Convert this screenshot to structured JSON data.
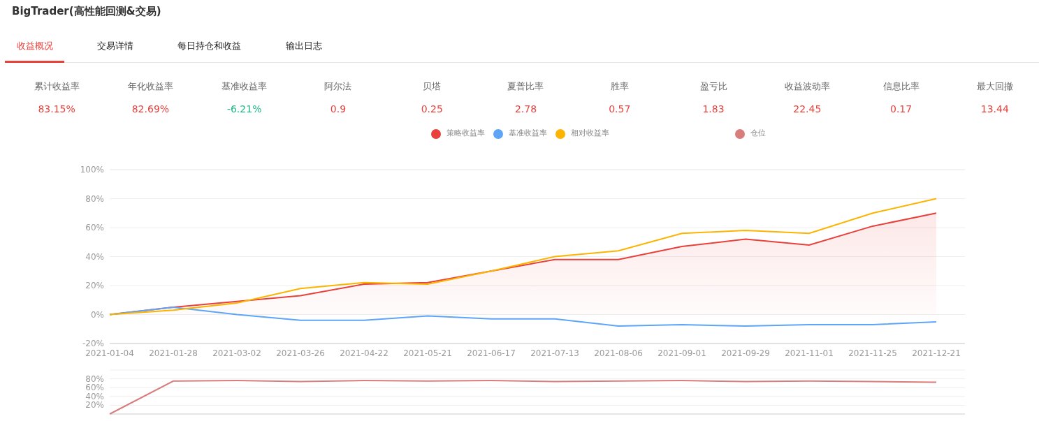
{
  "title": "BigTrader(高性能回测&交易)",
  "tabs": [
    {
      "label": "收益概况",
      "selected": true
    },
    {
      "label": "交易详情",
      "selected": false
    },
    {
      "label": "每日持仓和收益",
      "selected": false
    },
    {
      "label": "输出日志",
      "selected": false
    }
  ],
  "metrics": [
    {
      "label": "累计收益率",
      "value": "83.15%",
      "color": "#e8413c"
    },
    {
      "label": "年化收益率",
      "value": "82.69%",
      "color": "#e8413c"
    },
    {
      "label": "基准收益率",
      "value": "-6.21%",
      "color": "#1dbb86"
    },
    {
      "label": "阿尔法",
      "value": "0.9",
      "color": "#e8413c"
    },
    {
      "label": "贝塔",
      "value": "0.25",
      "color": "#e8413c"
    },
    {
      "label": "夏普比率",
      "value": "2.78",
      "color": "#e8413c"
    },
    {
      "label": "胜率",
      "value": "0.57",
      "color": "#e8413c"
    },
    {
      "label": "盈亏比",
      "value": "1.83",
      "color": "#e8413c"
    },
    {
      "label": "收益波动率",
      "value": "22.45",
      "color": "#e8413c"
    },
    {
      "label": "信息比率",
      "value": "0.17",
      "color": "#e8413c"
    },
    {
      "label": "最大回撤",
      "value": "13.44",
      "color": "#e8413c"
    }
  ],
  "returns_chart": {
    "chart_data": {
      "type": "line",
      "categories": [
        "2021-01-04",
        "2021-01-28",
        "2021-03-02",
        "2021-03-26",
        "2021-04-22",
        "2021-05-21",
        "2021-06-17",
        "2021-07-13",
        "2021-08-06",
        "2021-09-01",
        "2021-09-29",
        "2021-11-01",
        "2021-11-25",
        "2021-12-21"
      ],
      "series": [
        {
          "name": "策略收益率",
          "color": "#e8413c",
          "type": "area",
          "values": [
            0,
            5,
            9,
            13,
            21,
            22,
            30,
            38,
            38,
            47,
            52,
            48,
            61,
            70
          ]
        },
        {
          "name": "基准收益率",
          "color": "#5ea5f8",
          "values": [
            0,
            5,
            0,
            -4,
            -4,
            -1,
            -3,
            -3,
            -8,
            -7,
            -8,
            -7,
            -7,
            -5
          ]
        },
        {
          "name": "相对收益率",
          "color": "#fcb400",
          "values": [
            0,
            3,
            8,
            18,
            22,
            21,
            30,
            40,
            44,
            56,
            58,
            56,
            70,
            80
          ]
        }
      ],
      "ylim": [
        -20,
        100
      ],
      "yticks": [
        {
          "value": -20,
          "label": "-20%"
        },
        {
          "value": 0,
          "label": "0%"
        },
        {
          "value": 20,
          "label": "20%"
        },
        {
          "value": 40,
          "label": "40%"
        },
        {
          "value": 60,
          "label": "60%"
        },
        {
          "value": 80,
          "label": "80%"
        },
        {
          "value": 100,
          "label": "100%"
        }
      ],
      "grid": true
    }
  },
  "position_chart": {
    "chart_data": {
      "type": "line",
      "series": [
        {
          "name": "仓位",
          "color": "#d87c7c",
          "values": [
            0,
            75,
            76,
            74,
            76,
            75,
            76,
            74,
            75,
            76,
            74,
            75,
            74,
            72
          ]
        }
      ],
      "grid": true,
      "ylim": [
        0,
        100
      ],
      "yticks": [
        {
          "value": 20,
          "label": "20%"
        },
        {
          "value": 40,
          "label": "40%"
        },
        {
          "value": 60,
          "label": "60%"
        },
        {
          "value": 80,
          "label": "80%"
        }
      ]
    }
  }
}
